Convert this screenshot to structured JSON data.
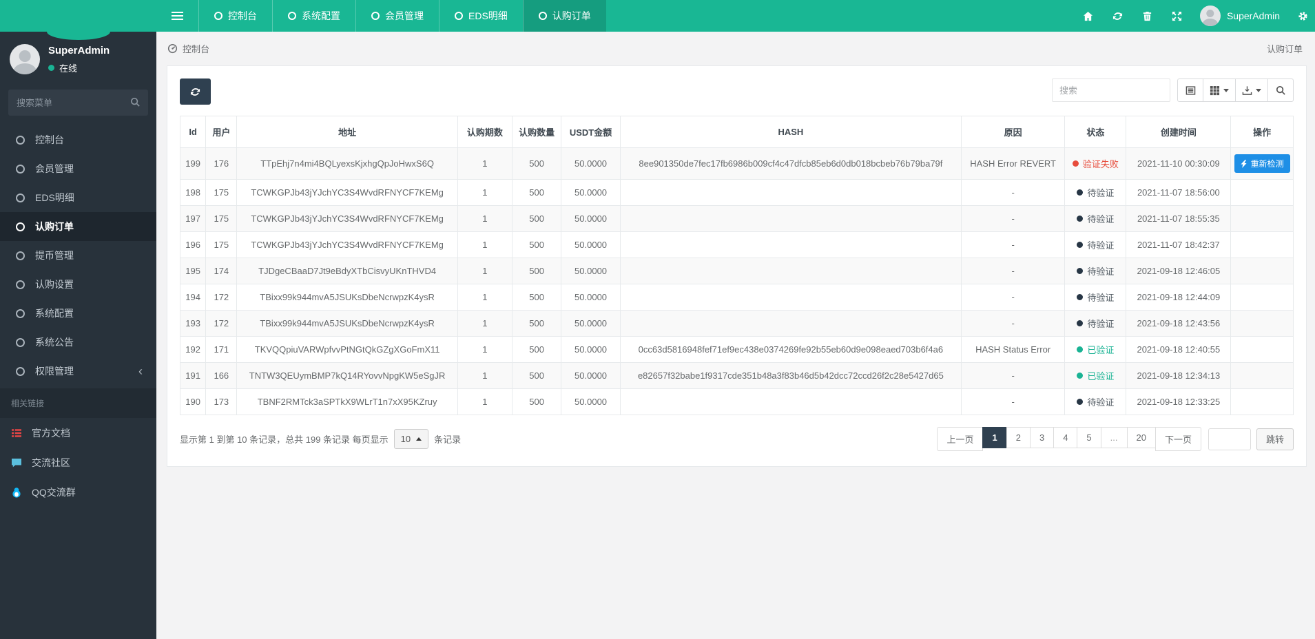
{
  "theme": {
    "topbar_green": "#19b794",
    "sidebar_dark": "#28323b",
    "panel_header_dark": "#2f4050",
    "action_blue": "#1e8fe6",
    "status_colors": {
      "failed": "#e74c3c",
      "pending": "#273645",
      "verified": "#1ab394"
    },
    "content_bg": "#f3f3f4"
  },
  "icons": {
    "hamburger-icon": "three-bars",
    "circle-icon": "hollow-circle",
    "home-icon": "house",
    "refresh-icon": "sync-arrows",
    "trash-icon": "trash-can",
    "fullscreen-icon": "four-arrows",
    "gears-icon": "cog",
    "search-icon": "magnifier",
    "dashboard-icon": "gauge",
    "doc-icon": "red-list",
    "comment-icon": "speech-bubble",
    "qq-icon": "penguin",
    "bolt-icon": "lightning",
    "detail-view-icon": "framed-lines",
    "columns-icon": "grid-squares",
    "export-icon": "arrow-into-tray",
    "caret": "triangle"
  },
  "navbar": {
    "tabs": [
      {
        "label": "控制台"
      },
      {
        "label": "系统配置"
      },
      {
        "label": "会员管理"
      },
      {
        "label": "EDS明细"
      },
      {
        "label": "认购订单",
        "active": true
      }
    ],
    "user_name": "SuperAdmin"
  },
  "sidebar": {
    "user": {
      "name": "SuperAdmin",
      "status": "在线"
    },
    "search_placeholder": "搜索菜单",
    "menu": [
      {
        "label": "控制台"
      },
      {
        "label": "会员管理"
      },
      {
        "label": "EDS明细"
      },
      {
        "label": "认购订单",
        "active": true
      },
      {
        "label": "提币管理"
      },
      {
        "label": "认购设置"
      },
      {
        "label": "系统配置"
      },
      {
        "label": "系统公告"
      },
      {
        "label": "权限管理",
        "has_children": true
      }
    ],
    "section_label": "相关链接",
    "links": [
      {
        "label": "官方文档",
        "icon": "icon-doc"
      },
      {
        "label": "交流社区",
        "icon": "icon-comment"
      },
      {
        "label": "QQ交流群",
        "icon": "icon-qq"
      }
    ]
  },
  "breadcrumb": {
    "left": "控制台",
    "right": "认购订单"
  },
  "toolbar": {
    "search_placeholder": "搜索"
  },
  "table": {
    "columns": [
      "Id",
      "用户",
      "地址",
      "认购期数",
      "认购数量",
      "USDT金额",
      "HASH",
      "原因",
      "状态",
      "创建时间",
      "操作"
    ],
    "rows": [
      {
        "id": "199",
        "user": "176",
        "address": "TTpEhj7n4mi4BQLyexsKjxhgQpJoHwxS6Q",
        "period": "1",
        "amount": "500",
        "usdt": "50.0000",
        "hash": "8ee901350de7fec17fb6986b009cf4c47dfcb85eb6d0db018bcbeb76b79ba79f",
        "reason": "HASH Error REVERT",
        "status": "验证失败",
        "status_type": "failed",
        "created": "2021-11-10 00:30:09",
        "action": "重新检测"
      },
      {
        "id": "198",
        "user": "175",
        "address": "TCWKGPJb43jYJchYC3S4WvdRFNYCF7KEMg",
        "period": "1",
        "amount": "500",
        "usdt": "50.0000",
        "hash": "",
        "reason": "-",
        "status": "待验证",
        "status_type": "pending",
        "created": "2021-11-07 18:56:00"
      },
      {
        "id": "197",
        "user": "175",
        "address": "TCWKGPJb43jYJchYC3S4WvdRFNYCF7KEMg",
        "period": "1",
        "amount": "500",
        "usdt": "50.0000",
        "hash": "",
        "reason": "-",
        "status": "待验证",
        "status_type": "pending",
        "created": "2021-11-07 18:55:35"
      },
      {
        "id": "196",
        "user": "175",
        "address": "TCWKGPJb43jYJchYC3S4WvdRFNYCF7KEMg",
        "period": "1",
        "amount": "500",
        "usdt": "50.0000",
        "hash": "",
        "reason": "-",
        "status": "待验证",
        "status_type": "pending",
        "created": "2021-11-07 18:42:37"
      },
      {
        "id": "195",
        "user": "174",
        "address": "TJDgeCBaaD7Jt9eBdyXTbCisvyUKnTHVD4",
        "period": "1",
        "amount": "500",
        "usdt": "50.0000",
        "hash": "",
        "reason": "-",
        "status": "待验证",
        "status_type": "pending",
        "created": "2021-09-18 12:46:05"
      },
      {
        "id": "194",
        "user": "172",
        "address": "TBixx99k944mvA5JSUKsDbeNcrwpzK4ysR",
        "period": "1",
        "amount": "500",
        "usdt": "50.0000",
        "hash": "",
        "reason": "-",
        "status": "待验证",
        "status_type": "pending",
        "created": "2021-09-18 12:44:09"
      },
      {
        "id": "193",
        "user": "172",
        "address": "TBixx99k944mvA5JSUKsDbeNcrwpzK4ysR",
        "period": "1",
        "amount": "500",
        "usdt": "50.0000",
        "hash": "",
        "reason": "-",
        "status": "待验证",
        "status_type": "pending",
        "created": "2021-09-18 12:43:56"
      },
      {
        "id": "192",
        "user": "171",
        "address": "TKVQQpiuVARWpfvvPtNGtQkGZgXGoFmX11",
        "period": "1",
        "amount": "500",
        "usdt": "50.0000",
        "hash": "0cc63d5816948fef71ef9ec438e0374269fe92b55eb60d9e098eaed703b6f4a6",
        "reason": "HASH Status Error",
        "status": "已验证",
        "status_type": "verified",
        "created": "2021-09-18 12:40:55"
      },
      {
        "id": "191",
        "user": "166",
        "address": "TNTW3QEUymBMP7kQ14RYovvNpgKW5eSgJR",
        "period": "1",
        "amount": "500",
        "usdt": "50.0000",
        "hash": "e82657f32babe1f9317cde351b48a3f83b46d5b42dcc72ccd26f2c28e5427d65",
        "reason": "-",
        "status": "已验证",
        "status_type": "verified",
        "created": "2021-09-18 12:34:13"
      },
      {
        "id": "190",
        "user": "173",
        "address": "TBNF2RMTck3aSPTkX9WLrT1n7xX95KZruy",
        "period": "1",
        "amount": "500",
        "usdt": "50.0000",
        "hash": "",
        "reason": "-",
        "status": "待验证",
        "status_type": "pending",
        "created": "2021-09-18 12:33:25"
      }
    ]
  },
  "footer": {
    "summary_prefix": "显示第 1 到第 10 条记录，总共 199 条记录 每页显示",
    "page_size": "10",
    "summary_suffix": "条记录",
    "pagination": {
      "prev": "上一页",
      "pages": [
        {
          "label": "1",
          "active": true
        },
        {
          "label": "2"
        },
        {
          "label": "3"
        },
        {
          "label": "4"
        },
        {
          "label": "5"
        },
        {
          "label": "...",
          "disabled": true
        },
        {
          "label": "20"
        }
      ],
      "next": "下一页",
      "jump_label": "跳转"
    }
  }
}
